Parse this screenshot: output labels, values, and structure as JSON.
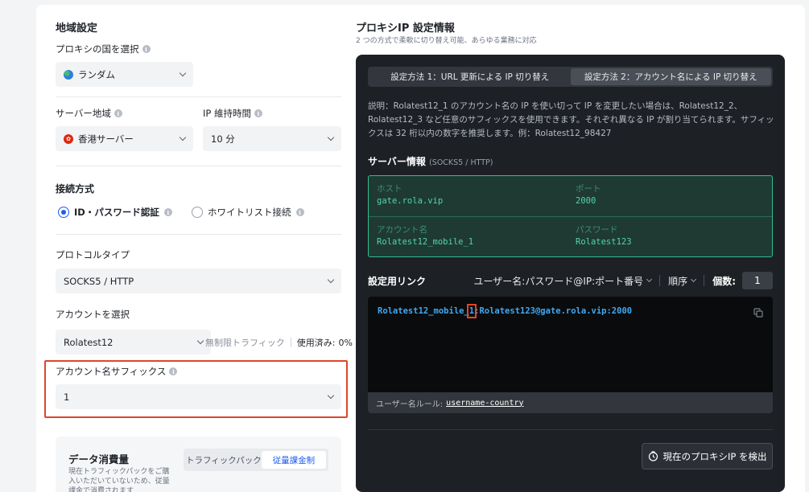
{
  "left": {
    "region_title": "地域設定",
    "country_label": "プロキシの国を選択",
    "country_value": "ランダム",
    "server_region_label": "サーバー地域",
    "server_region_value": "香港サーバー",
    "ip_duration_label": "IP 維持時間",
    "ip_duration_value": "10 分",
    "connection_title": "接続方式",
    "radio_id_password": "ID・パスワード認証",
    "radio_whitelist": "ホワイトリスト接続",
    "protocol_label": "プロトコルタイプ",
    "protocol_value": "SOCKS5 / HTTP",
    "account_label": "アカウントを選択",
    "account_value": "Rolatest12",
    "account_traffic": "無制限トラフィック",
    "account_used": "使用済み:",
    "account_used_value": "0%",
    "suffix_label": "アカウント名サフィックス",
    "suffix_value": "1",
    "data_title": "データ消費量",
    "data_desc": "現在トラフィックパックをご購入いただいていないため、従量課金で消費されます",
    "seg_traffic_pack": "トラフィックパック",
    "seg_pay_as_you_go": "従量課金制"
  },
  "right": {
    "title": "プロキシIP 設定情報",
    "subtitle": "2 つの方式で柔軟に切り替え可能、あらゆる業務に対応",
    "tab1": "設定方法 1：URL 更新による IP 切り替え",
    "tab2": "設定方法 2：アカウント名による IP 切り替え",
    "description": "説明：Rolatest12_1 のアカウント名の IP を使い切って IP を変更したい場合は、Rolatest12_2、Rolatest12_3 など任意のサフィックスを使用できます。それぞれ異なる IP が割り当てられます。サフィックスは 32 桁以内の数字を推奨します。例：Rolatest12_98427",
    "server_title": "サーバー情報",
    "server_subtitle": "(SOCKS5 / HTTP)",
    "host_label": "ホスト",
    "host_value": "gate.rola.vip",
    "port_label": "ポート",
    "port_value": "2000",
    "account_name_label": "アカウント名",
    "account_name_value": "Rolatest12_mobile_1",
    "password_label": "パスワード",
    "password_value": "Rolatest123",
    "link_title": "設定用リンク",
    "format_option": "ユーザー名:パスワード@IP:ポート番号",
    "order_option": "順序",
    "count_label": "個数:",
    "count_value": "1",
    "link_prefix": "Rolatest12_mobile_",
    "link_suffix_digit": "1",
    "link_rest": ":Rolatest123@gate.rola.vip:2000",
    "rule_label": "ユーザー名ルール:",
    "rule_username": "username",
    "rule_dash": "-",
    "rule_country": "country",
    "detect_button": "現在のプロキシIP を検出"
  },
  "colors": {
    "accent": "#1f5cf0",
    "highlight_box": "#e0452b",
    "server_green": "#52d6a6",
    "link_blue": "#3fa9f5",
    "dark_panel": "#1d2025"
  }
}
